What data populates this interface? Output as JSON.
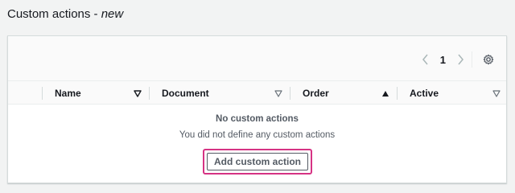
{
  "page": {
    "title": "Custom actions",
    "title_separator": " - ",
    "title_suffix": "new"
  },
  "pagination": {
    "current_page": "1",
    "prev_icon": "chevron-left-icon",
    "next_icon": "chevron-right-icon",
    "settings_icon": "gear-icon"
  },
  "table": {
    "columns": [
      {
        "label": "Name",
        "sort": "unsorted"
      },
      {
        "label": "Document",
        "sort": "unsorted"
      },
      {
        "label": "Order",
        "sort": "ascending"
      },
      {
        "label": "Active",
        "sort": "unsorted"
      }
    ],
    "empty_title": "No custom actions",
    "empty_message": "You did not define any custom actions",
    "add_button_label": "Add custom action"
  },
  "colors": {
    "highlight_border": "#d63384",
    "text_primary": "#16191f",
    "text_secondary": "#545b64"
  }
}
